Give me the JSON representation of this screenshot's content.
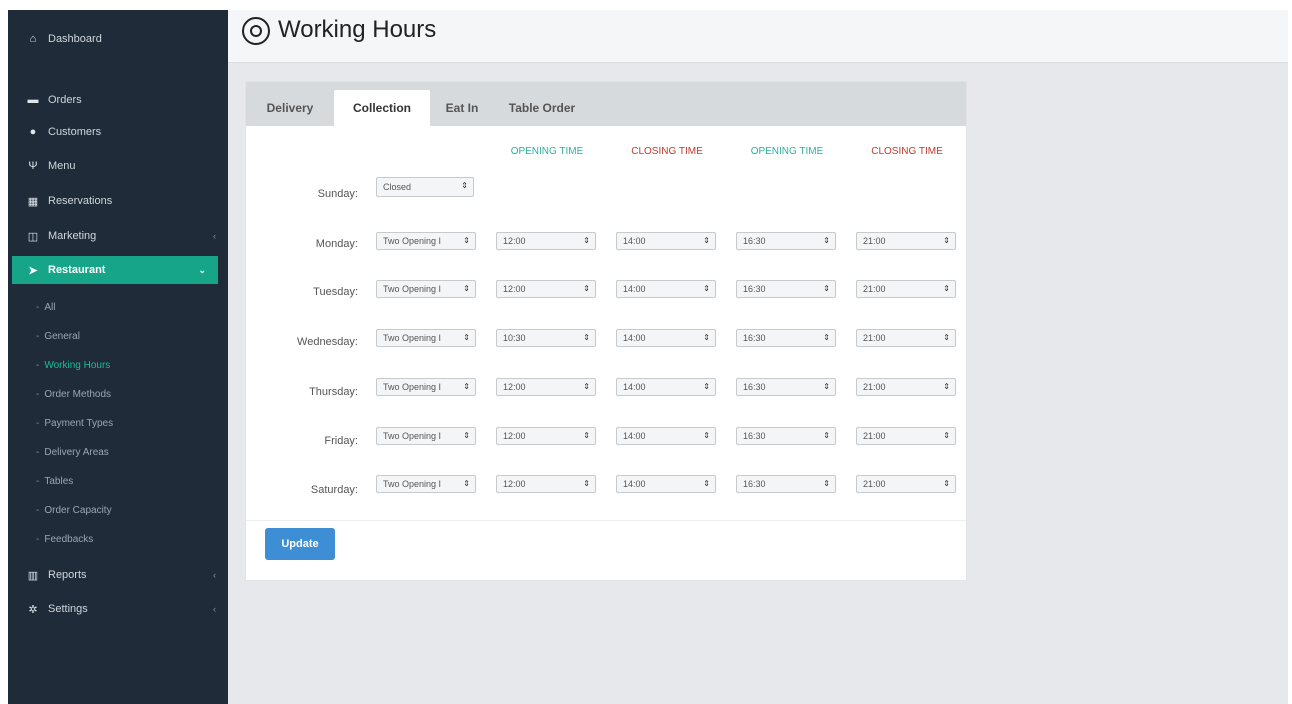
{
  "sidebar": {
    "items": [
      {
        "label": "Dashboard",
        "icon": "dashboard-icon"
      },
      {
        "label": "Orders",
        "icon": "cart-icon"
      },
      {
        "label": "Customers",
        "icon": "users-icon"
      },
      {
        "label": "Menu",
        "icon": "cutlery-icon"
      },
      {
        "label": "Reservations",
        "icon": "calendar-icon"
      },
      {
        "label": "Marketing",
        "icon": "marketing-icon"
      },
      {
        "label": "Restaurant",
        "icon": "location-arrow-icon"
      },
      {
        "label": "Reports",
        "icon": "bar-chart-icon"
      },
      {
        "label": "Settings",
        "icon": "gear-icon"
      }
    ],
    "subitems": [
      "All",
      "General",
      "Working Hours",
      "Order Methods",
      "Payment Types",
      "Delivery Areas",
      "Tables",
      "Order Capacity",
      "Feedbacks"
    ],
    "active_item": "Restaurant",
    "active_subitem": "Working Hours",
    "accent": "#17a589"
  },
  "header": {
    "title": "Working Hours"
  },
  "tabs": [
    {
      "label": "Delivery"
    },
    {
      "label": "Collection"
    },
    {
      "label": "Eat In"
    },
    {
      "label": "Table Order"
    }
  ],
  "active_tab": "Collection",
  "columns": [
    "OPENING TIME",
    "CLOSING TIME",
    "OPENING TIME",
    "CLOSING TIME"
  ],
  "days": [
    {
      "label": "Sunday:",
      "mode": "Closed",
      "times": []
    },
    {
      "label": "Monday:",
      "mode": "Two Opening I",
      "times": [
        "12:00",
        "14:00",
        "16:30",
        "21:00"
      ]
    },
    {
      "label": "Tuesday:",
      "mode": "Two Opening I",
      "times": [
        "12:00",
        "14:00",
        "16:30",
        "21:00"
      ]
    },
    {
      "label": "Wednesday:",
      "mode": "Two Opening I",
      "times": [
        "10:30",
        "14:00",
        "16:30",
        "21:00"
      ]
    },
    {
      "label": "Thursday:",
      "mode": "Two Opening I",
      "times": [
        "12:00",
        "14:00",
        "16:30",
        "21:00"
      ]
    },
    {
      "label": "Friday:",
      "mode": "Two Opening I",
      "times": [
        "12:00",
        "14:00",
        "16:30",
        "21:00"
      ]
    },
    {
      "label": "Saturday:",
      "mode": "Two Opening I",
      "times": [
        "12:00",
        "14:00",
        "16:30",
        "21:00"
      ]
    }
  ],
  "update_label": "Update",
  "colors": {
    "opening": "#2bb39a",
    "closing": "#c0392b",
    "button": "#3e8ed6"
  }
}
